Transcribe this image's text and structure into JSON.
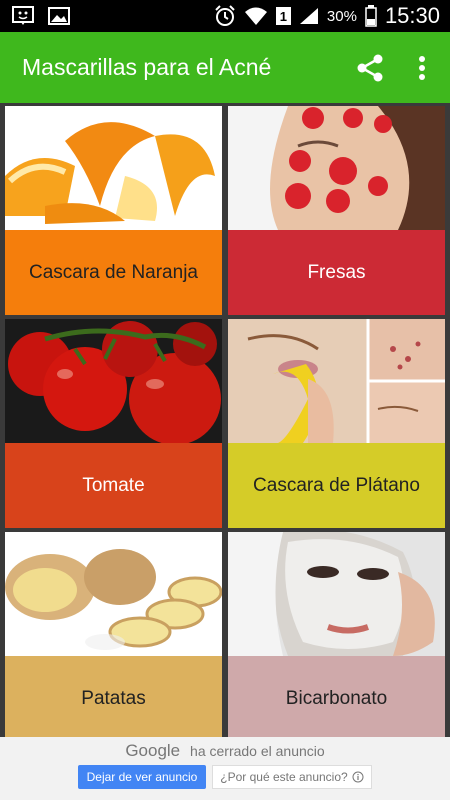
{
  "status_bar": {
    "time": "15:30",
    "battery": "30%",
    "sim": "1",
    "icons": [
      "notification-icon",
      "image-icon",
      "alarm-icon",
      "wifi-icon",
      "sim-icon",
      "signal-icon",
      "battery-icon"
    ]
  },
  "app_bar": {
    "title": "Mascarillas para el Acné",
    "icons": [
      "share-icon",
      "more-vert-icon"
    ]
  },
  "cards": [
    {
      "label": "Cascara de Naranja",
      "color": "#f57e0c",
      "text_color": "#222222",
      "image": "orange-peel"
    },
    {
      "label": "Fresas",
      "color": "#cc2a35",
      "text_color": "#ffffff",
      "image": "strawberry-face"
    },
    {
      "label": "Tomate",
      "color": "#d8431b",
      "text_color": "#ffffff",
      "image": "tomatoes"
    },
    {
      "label": "Cascara de Plátano",
      "color": "#d5cc28",
      "text_color": "#222222",
      "image": "banana-face"
    },
    {
      "label": "Patatas",
      "color": "#dcb15e",
      "text_color": "#222222",
      "image": "potatoes"
    },
    {
      "label": "Bicarbonato",
      "color": "#cfa9aa",
      "text_color": "#222222",
      "image": "mask-face"
    }
  ],
  "ad": {
    "brand": "Google",
    "message": "ha cerrado el anuncio",
    "stop_button": "Dejar de ver anuncio",
    "why_button": "¿Por qué este anuncio?",
    "info_icon": "info-icon"
  }
}
